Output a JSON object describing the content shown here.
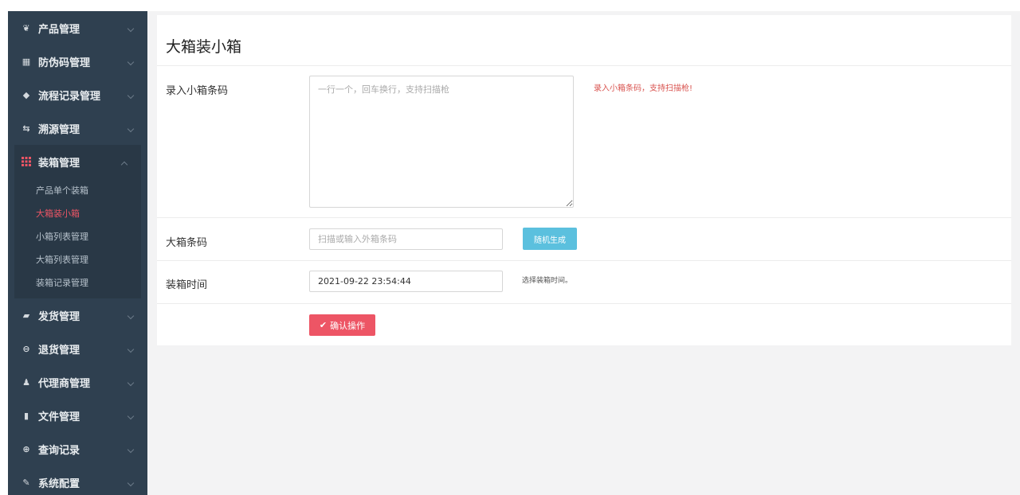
{
  "sidebar": {
    "items_before": [
      {
        "label": "产品管理",
        "icon": "leaf-icon"
      },
      {
        "label": "防伪码管理",
        "icon": "barcode-icon"
      },
      {
        "label": "流程记录管理",
        "icon": "tags-icon"
      },
      {
        "label": "溯源管理",
        "icon": "retweet-icon"
      }
    ],
    "active_group": {
      "label": "装箱管理",
      "icon": "grid-icon",
      "sub_items": [
        {
          "label": "产品单个装箱"
        },
        {
          "label": "大箱装小箱"
        },
        {
          "label": "小箱列表管理"
        },
        {
          "label": "大箱列表管理"
        },
        {
          "label": "装箱记录管理"
        }
      ],
      "active_sub_index": 1
    },
    "items_after": [
      {
        "label": "发货管理",
        "icon": "truck-icon"
      },
      {
        "label": "退货管理",
        "icon": "minus-circle-icon"
      },
      {
        "label": "代理商管理",
        "icon": "users-icon"
      },
      {
        "label": "文件管理",
        "icon": "file-icon"
      },
      {
        "label": "查询记录",
        "icon": "search-icon"
      },
      {
        "label": "系统配置",
        "icon": "wrench-icon"
      }
    ]
  },
  "panel": {
    "title": "大箱装小箱",
    "small_codes": {
      "label": "录入小箱条码",
      "placeholder": "一行一个，回车换行，支持扫描枪",
      "value": "",
      "hint": "录入小箱条码，支持扫描枪!"
    },
    "big_code": {
      "label": "大箱条码",
      "placeholder": "扫描或输入外箱条码",
      "value": "",
      "random_button": "随机生成"
    },
    "pack_time": {
      "label": "装箱时间",
      "value": "2021-09-22 23:54:44",
      "hint": "选择装箱时间。"
    },
    "confirm_button": "确认操作"
  },
  "colors": {
    "sidebar_bg": "#2f4050",
    "accent_red": "#ed5565",
    "info_blue": "#5bc0de"
  }
}
